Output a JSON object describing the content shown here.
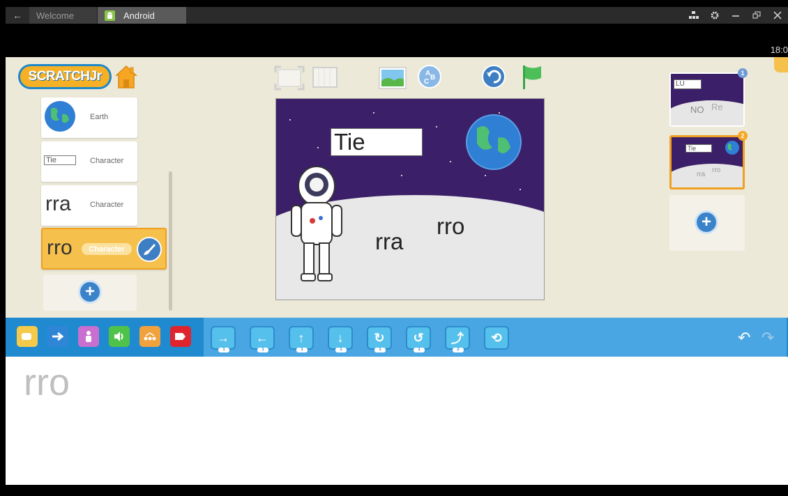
{
  "titlebar": {
    "back": "←",
    "tabs": [
      {
        "label": "Welcome"
      },
      {
        "label": "Android"
      }
    ],
    "controls": [
      "apps-icon",
      "gear-icon",
      "minimize-icon",
      "restore-icon",
      "close-icon"
    ]
  },
  "status": {
    "clock": "18:0"
  },
  "app": {
    "logo": "SCRATCHJr",
    "sprites": [
      {
        "name": "Earth",
        "kind": "planet"
      },
      {
        "name": "Character",
        "preview": "Tie"
      },
      {
        "name": "Character",
        "preview": "rra"
      },
      {
        "name": "Character",
        "preview": "rro",
        "selected": true
      }
    ],
    "stage": {
      "title_text": "Tie",
      "texts": [
        "rra",
        "rro"
      ]
    },
    "pages": [
      {
        "number": "1",
        "preview_title": "LU",
        "preview_texts": [
          "NO",
          "Re"
        ]
      },
      {
        "number": "2",
        "preview_title": "Tie",
        "preview_texts": [
          "rra",
          "rro"
        ],
        "current": true
      }
    ],
    "palette": {
      "categories": [
        {
          "name": "triggering",
          "color": "#f5c94a"
        },
        {
          "name": "motion",
          "color": "#2f86d6"
        },
        {
          "name": "looks",
          "color": "#c96fd0"
        },
        {
          "name": "sound",
          "color": "#4fc24a"
        },
        {
          "name": "control",
          "color": "#f2a23d"
        },
        {
          "name": "end",
          "color": "#e0242e"
        }
      ],
      "blocks": [
        {
          "name": "move-right",
          "glyph": "→",
          "count": "1"
        },
        {
          "name": "move-left",
          "glyph": "←",
          "count": "1"
        },
        {
          "name": "move-up",
          "glyph": "↑",
          "count": "1"
        },
        {
          "name": "move-down",
          "glyph": "↓",
          "count": "1"
        },
        {
          "name": "turn-right",
          "glyph": "↻",
          "count": "1"
        },
        {
          "name": "turn-left",
          "glyph": "↺",
          "count": "1"
        },
        {
          "name": "hop",
          "glyph": "⤴",
          "count": "2"
        },
        {
          "name": "go-home",
          "glyph": "⟲",
          "count": ""
        }
      ]
    },
    "script": {
      "sprite_name": "rro"
    }
  }
}
